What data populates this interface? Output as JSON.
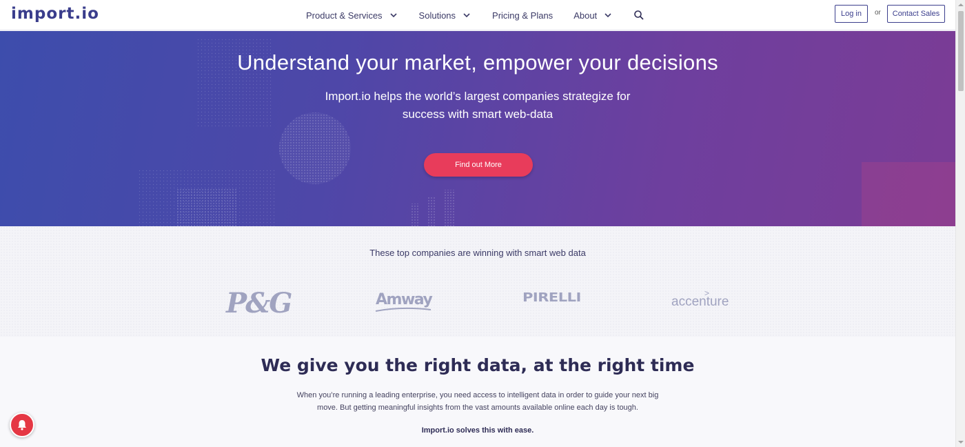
{
  "header": {
    "logo": "import.io",
    "nav": [
      {
        "label": "Product & Services",
        "has_dropdown": true
      },
      {
        "label": "Solutions",
        "has_dropdown": true
      },
      {
        "label": "Pricing & Plans",
        "has_dropdown": false
      },
      {
        "label": "About",
        "has_dropdown": true
      }
    ],
    "search_icon": "search-icon",
    "login_label": "Log in",
    "or_label": "or",
    "contact_label": "Contact Sales"
  },
  "hero": {
    "title": "Understand your market, empower your decisions",
    "subtitle": "Import.io helps the world’s largest companies strategize for success with smart web-data",
    "cta_label": "Find out More"
  },
  "clients": {
    "title": "These top companies are winning with smart web data",
    "logos": [
      "P&G",
      "Amway",
      "PIRELLI",
      "accenture"
    ]
  },
  "content": {
    "title": "We give you the right data, at the right time",
    "body": "When you’re running a leading enterprise, you need access to intelligent data in order to guide your next big move. But getting meaningful insights from the vast amounts available online each day is tough.",
    "strong": "Import.io solves this with ease."
  },
  "notification": {
    "icon": "bell-icon"
  },
  "colors": {
    "brand": "#3a3d8c",
    "hero_start": "#3d4dac",
    "hero_end": "#7b3c95",
    "cta": "#e83c5b",
    "notification": "#e53744"
  }
}
